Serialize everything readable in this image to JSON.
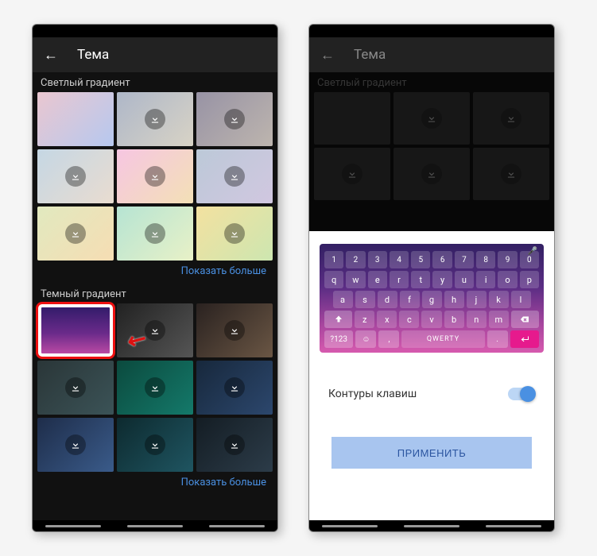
{
  "left": {
    "header": {
      "title": "Тема"
    },
    "sections": {
      "light": {
        "title": "Светлый градиент",
        "show_more": "Показать больше"
      },
      "dark": {
        "title": "Темный градиент",
        "show_more": "Показать больше"
      }
    }
  },
  "right": {
    "header": {
      "title": "Тема"
    },
    "section_light_title": "Светлый градиент",
    "keyboard": {
      "row_num": [
        "1",
        "2",
        "3",
        "4",
        "5",
        "6",
        "7",
        "8",
        "9",
        "0"
      ],
      "row1": [
        "q",
        "w",
        "e",
        "r",
        "t",
        "y",
        "u",
        "i",
        "o",
        "p"
      ],
      "row2": [
        "a",
        "s",
        "d",
        "f",
        "g",
        "h",
        "j",
        "k",
        "l"
      ],
      "row3": [
        "z",
        "x",
        "c",
        "v",
        "b",
        "n",
        "m"
      ],
      "fn123": "?123",
      "space_label": "QWERTY",
      "period": "."
    },
    "toggle": {
      "label": "Контуры клавиш",
      "on": true
    },
    "apply": "ПРИМЕНИТЬ"
  }
}
